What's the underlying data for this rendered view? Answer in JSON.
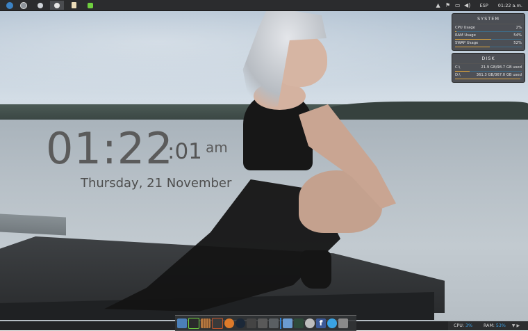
{
  "taskbar": {
    "apps": [
      {
        "name": "app-1",
        "color": "#3b82c4"
      },
      {
        "name": "app-2",
        "color": "#9aa0a6"
      },
      {
        "name": "app-3",
        "color": "#d0d0d0"
      },
      {
        "name": "app-4",
        "color": "#e8d9b5"
      },
      {
        "name": "app-5",
        "color": "#6fcf3f"
      }
    ],
    "tray_icons": [
      "chevron-up-icon",
      "flag-icon",
      "network-icon",
      "volume-icon",
      "action-center-icon"
    ],
    "language": "ESP",
    "time": "01:22 a.m."
  },
  "clock": {
    "hours_minutes": "01:22",
    "seconds": ":01",
    "ampm": "am",
    "date": "Thursday, 21 November"
  },
  "system_widget": {
    "title": "SYSTEM",
    "rows": [
      {
        "label": "CPU Usage",
        "value": "2%",
        "level": 0.02
      },
      {
        "label": "RAM Usage",
        "value": "54%",
        "level": 0.54
      },
      {
        "label": "SWAP Usage",
        "value": "52%",
        "level": 0.52
      }
    ]
  },
  "disk_widget": {
    "title": "DISK",
    "rows": [
      {
        "label": "C:\\",
        "value": "21.9 GB/98.7 GB used",
        "level": 0.22
      },
      {
        "label": "D:\\",
        "value": "361.3 GB/367.0 GB used",
        "level": 0.98
      }
    ]
  },
  "dock": {
    "items": [
      "monitor-icon",
      "display-icon",
      "books-icon",
      "media-icon",
      "disc-icon",
      "steam-icon",
      "film-icon",
      "tools-icon",
      "grid-icon",
      "window-icon",
      "activity-icon",
      "cloud-icon",
      "facebook-icon",
      "chat-icon",
      "network-icon"
    ]
  },
  "status": {
    "cpu_label": "CPU:",
    "cpu_value": "3%",
    "ram_label": "RAM:",
    "ram_value": "53%"
  },
  "colors": {
    "bar_fill": "#e0a63b",
    "bar_track": "#3d6e8c",
    "accent": "#3fa4e8"
  }
}
